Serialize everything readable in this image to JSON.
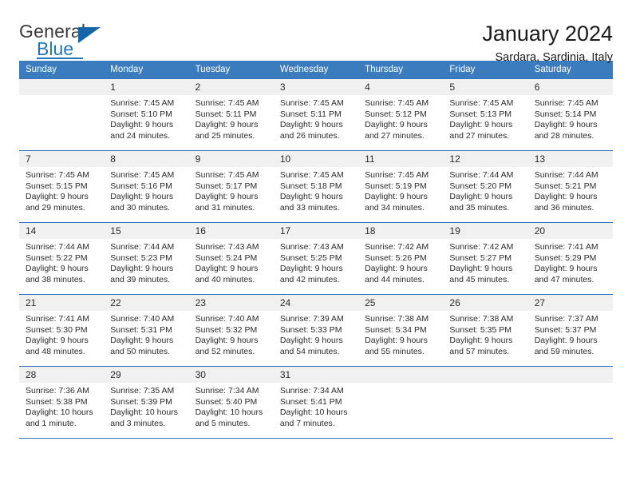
{
  "logo": {
    "primary_text": "General",
    "secondary_text": "Blue",
    "primary_color": "#3a3a3a",
    "secondary_color": "#2175bc",
    "triangle_color": "#1565a8"
  },
  "header": {
    "title": "January 2024",
    "subtitle": "Sardara, Sardinia, Italy"
  },
  "theme": {
    "header_bg": "#3a7cbe",
    "header_text": "#ffffff",
    "row_border": "#2f74bb",
    "daynum_bg": "#f0f0f0",
    "body_text": "#2b2b2b"
  },
  "weekday_headers": [
    "Sunday",
    "Monday",
    "Tuesday",
    "Wednesday",
    "Thursday",
    "Friday",
    "Saturday"
  ],
  "labels": {
    "sunrise_prefix": "Sunrise:",
    "sunset_prefix": "Sunset:",
    "daylight_prefix": "Daylight:"
  },
  "weeks": [
    [
      {
        "day": "",
        "empty": true,
        "sunrise": "",
        "sunset": "",
        "daylight_line1": "",
        "daylight_line2": ""
      },
      {
        "day": "1",
        "sunrise": "Sunrise: 7:45 AM",
        "sunset": "Sunset: 5:10 PM",
        "daylight_line1": "Daylight: 9 hours",
        "daylight_line2": "and 24 minutes."
      },
      {
        "day": "2",
        "sunrise": "Sunrise: 7:45 AM",
        "sunset": "Sunset: 5:11 PM",
        "daylight_line1": "Daylight: 9 hours",
        "daylight_line2": "and 25 minutes."
      },
      {
        "day": "3",
        "sunrise": "Sunrise: 7:45 AM",
        "sunset": "Sunset: 5:11 PM",
        "daylight_line1": "Daylight: 9 hours",
        "daylight_line2": "and 26 minutes."
      },
      {
        "day": "4",
        "sunrise": "Sunrise: 7:45 AM",
        "sunset": "Sunset: 5:12 PM",
        "daylight_line1": "Daylight: 9 hours",
        "daylight_line2": "and 27 minutes."
      },
      {
        "day": "5",
        "sunrise": "Sunrise: 7:45 AM",
        "sunset": "Sunset: 5:13 PM",
        "daylight_line1": "Daylight: 9 hours",
        "daylight_line2": "and 27 minutes."
      },
      {
        "day": "6",
        "sunrise": "Sunrise: 7:45 AM",
        "sunset": "Sunset: 5:14 PM",
        "daylight_line1": "Daylight: 9 hours",
        "daylight_line2": "and 28 minutes."
      }
    ],
    [
      {
        "day": "7",
        "sunrise": "Sunrise: 7:45 AM",
        "sunset": "Sunset: 5:15 PM",
        "daylight_line1": "Daylight: 9 hours",
        "daylight_line2": "and 29 minutes."
      },
      {
        "day": "8",
        "sunrise": "Sunrise: 7:45 AM",
        "sunset": "Sunset: 5:16 PM",
        "daylight_line1": "Daylight: 9 hours",
        "daylight_line2": "and 30 minutes."
      },
      {
        "day": "9",
        "sunrise": "Sunrise: 7:45 AM",
        "sunset": "Sunset: 5:17 PM",
        "daylight_line1": "Daylight: 9 hours",
        "daylight_line2": "and 31 minutes."
      },
      {
        "day": "10",
        "sunrise": "Sunrise: 7:45 AM",
        "sunset": "Sunset: 5:18 PM",
        "daylight_line1": "Daylight: 9 hours",
        "daylight_line2": "and 33 minutes."
      },
      {
        "day": "11",
        "sunrise": "Sunrise: 7:45 AM",
        "sunset": "Sunset: 5:19 PM",
        "daylight_line1": "Daylight: 9 hours",
        "daylight_line2": "and 34 minutes."
      },
      {
        "day": "12",
        "sunrise": "Sunrise: 7:44 AM",
        "sunset": "Sunset: 5:20 PM",
        "daylight_line1": "Daylight: 9 hours",
        "daylight_line2": "and 35 minutes."
      },
      {
        "day": "13",
        "sunrise": "Sunrise: 7:44 AM",
        "sunset": "Sunset: 5:21 PM",
        "daylight_line1": "Daylight: 9 hours",
        "daylight_line2": "and 36 minutes."
      }
    ],
    [
      {
        "day": "14",
        "sunrise": "Sunrise: 7:44 AM",
        "sunset": "Sunset: 5:22 PM",
        "daylight_line1": "Daylight: 9 hours",
        "daylight_line2": "and 38 minutes."
      },
      {
        "day": "15",
        "sunrise": "Sunrise: 7:44 AM",
        "sunset": "Sunset: 5:23 PM",
        "daylight_line1": "Daylight: 9 hours",
        "daylight_line2": "and 39 minutes."
      },
      {
        "day": "16",
        "sunrise": "Sunrise: 7:43 AM",
        "sunset": "Sunset: 5:24 PM",
        "daylight_line1": "Daylight: 9 hours",
        "daylight_line2": "and 40 minutes."
      },
      {
        "day": "17",
        "sunrise": "Sunrise: 7:43 AM",
        "sunset": "Sunset: 5:25 PM",
        "daylight_line1": "Daylight: 9 hours",
        "daylight_line2": "and 42 minutes."
      },
      {
        "day": "18",
        "sunrise": "Sunrise: 7:42 AM",
        "sunset": "Sunset: 5:26 PM",
        "daylight_line1": "Daylight: 9 hours",
        "daylight_line2": "and 44 minutes."
      },
      {
        "day": "19",
        "sunrise": "Sunrise: 7:42 AM",
        "sunset": "Sunset: 5:27 PM",
        "daylight_line1": "Daylight: 9 hours",
        "daylight_line2": "and 45 minutes."
      },
      {
        "day": "20",
        "sunrise": "Sunrise: 7:41 AM",
        "sunset": "Sunset: 5:29 PM",
        "daylight_line1": "Daylight: 9 hours",
        "daylight_line2": "and 47 minutes."
      }
    ],
    [
      {
        "day": "21",
        "sunrise": "Sunrise: 7:41 AM",
        "sunset": "Sunset: 5:30 PM",
        "daylight_line1": "Daylight: 9 hours",
        "daylight_line2": "and 48 minutes."
      },
      {
        "day": "22",
        "sunrise": "Sunrise: 7:40 AM",
        "sunset": "Sunset: 5:31 PM",
        "daylight_line1": "Daylight: 9 hours",
        "daylight_line2": "and 50 minutes."
      },
      {
        "day": "23",
        "sunrise": "Sunrise: 7:40 AM",
        "sunset": "Sunset: 5:32 PM",
        "daylight_line1": "Daylight: 9 hours",
        "daylight_line2": "and 52 minutes."
      },
      {
        "day": "24",
        "sunrise": "Sunrise: 7:39 AM",
        "sunset": "Sunset: 5:33 PM",
        "daylight_line1": "Daylight: 9 hours",
        "daylight_line2": "and 54 minutes."
      },
      {
        "day": "25",
        "sunrise": "Sunrise: 7:38 AM",
        "sunset": "Sunset: 5:34 PM",
        "daylight_line1": "Daylight: 9 hours",
        "daylight_line2": "and 55 minutes."
      },
      {
        "day": "26",
        "sunrise": "Sunrise: 7:38 AM",
        "sunset": "Sunset: 5:35 PM",
        "daylight_line1": "Daylight: 9 hours",
        "daylight_line2": "and 57 minutes."
      },
      {
        "day": "27",
        "sunrise": "Sunrise: 7:37 AM",
        "sunset": "Sunset: 5:37 PM",
        "daylight_line1": "Daylight: 9 hours",
        "daylight_line2": "and 59 minutes."
      }
    ],
    [
      {
        "day": "28",
        "sunrise": "Sunrise: 7:36 AM",
        "sunset": "Sunset: 5:38 PM",
        "daylight_line1": "Daylight: 10 hours",
        "daylight_line2": "and 1 minute."
      },
      {
        "day": "29",
        "sunrise": "Sunrise: 7:35 AM",
        "sunset": "Sunset: 5:39 PM",
        "daylight_line1": "Daylight: 10 hours",
        "daylight_line2": "and 3 minutes."
      },
      {
        "day": "30",
        "sunrise": "Sunrise: 7:34 AM",
        "sunset": "Sunset: 5:40 PM",
        "daylight_line1": "Daylight: 10 hours",
        "daylight_line2": "and 5 minutes."
      },
      {
        "day": "31",
        "sunrise": "Sunrise: 7:34 AM",
        "sunset": "Sunset: 5:41 PM",
        "daylight_line1": "Daylight: 10 hours",
        "daylight_line2": "and 7 minutes."
      },
      {
        "day": "",
        "empty": true,
        "sunrise": "",
        "sunset": "",
        "daylight_line1": "",
        "daylight_line2": ""
      },
      {
        "day": "",
        "empty": true,
        "sunrise": "",
        "sunset": "",
        "daylight_line1": "",
        "daylight_line2": ""
      },
      {
        "day": "",
        "empty": true,
        "sunrise": "",
        "sunset": "",
        "daylight_line1": "",
        "daylight_line2": ""
      }
    ]
  ]
}
